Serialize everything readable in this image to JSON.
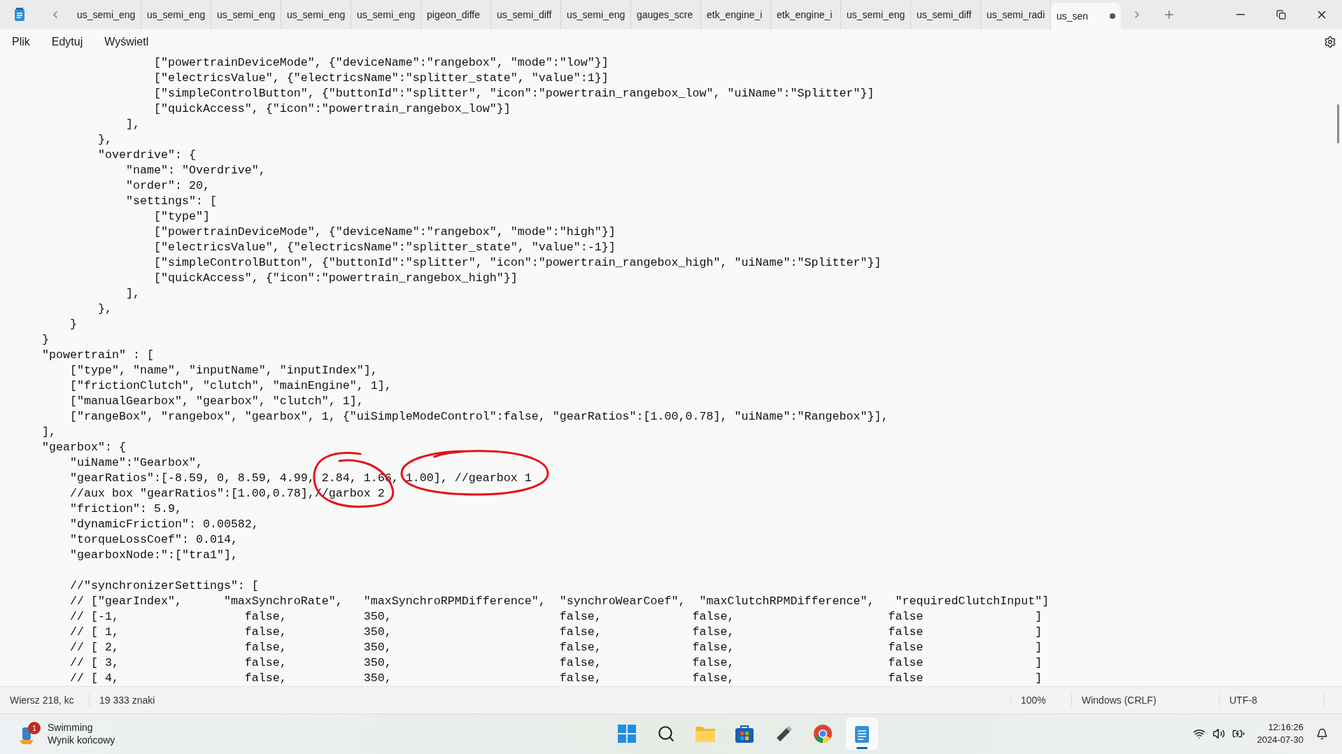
{
  "tabs": [
    {
      "label": "us_semi_eng",
      "selected": false,
      "unsaved": false
    },
    {
      "label": "us_semi_eng",
      "selected": false,
      "unsaved": false
    },
    {
      "label": "us_semi_eng",
      "selected": false,
      "unsaved": false
    },
    {
      "label": "us_semi_eng",
      "selected": false,
      "unsaved": false
    },
    {
      "label": "us_semi_eng",
      "selected": false,
      "unsaved": false
    },
    {
      "label": "pigeon_diffe",
      "selected": false,
      "unsaved": false
    },
    {
      "label": "us_semi_diff",
      "selected": false,
      "unsaved": false
    },
    {
      "label": "us_semi_eng",
      "selected": false,
      "unsaved": false
    },
    {
      "label": "gauges_scre",
      "selected": false,
      "unsaved": false
    },
    {
      "label": "etk_engine_i",
      "selected": false,
      "unsaved": false
    },
    {
      "label": "etk_engine_i",
      "selected": false,
      "unsaved": false
    },
    {
      "label": "us_semi_eng",
      "selected": false,
      "unsaved": false
    },
    {
      "label": "us_semi_diff",
      "selected": false,
      "unsaved": false
    },
    {
      "label": "us_semi_radi",
      "selected": false,
      "unsaved": false
    },
    {
      "label": "us_sen",
      "selected": true,
      "unsaved": true
    }
  ],
  "menu": [
    "Plik",
    "Edytuj",
    "Wyświetl"
  ],
  "editor": {
    "blocks": [
      [
        "                [\"powertrainDeviceMode\", {\"deviceName\":\"rangebox\", \"mode\":\"low\"}]",
        "                [\"electricsValue\", {\"electricsName\":\"splitter_state\", \"value\":1}]",
        "                [\"simpleControlButton\", {\"buttonId\":\"splitter\", \"icon\":\"powertrain_rangebox_low\", \"uiName\":\"Splitter\"}]",
        "                [\"quickAccess\", {\"icon\":\"powertrain_rangebox_low\"}]",
        "            ],",
        "        },",
        "        \"overdrive\": {",
        "            \"name\": \"Overdrive\",",
        "            \"order\": 20,",
        "            \"settings\": [",
        "                [\"type\"]",
        "                [\"powertrainDeviceMode\", {\"deviceName\":\"rangebox\", \"mode\":\"high\"}]",
        "                [\"electricsValue\", {\"electricsName\":\"splitter_state\", \"value\":-1}]",
        "                [\"simpleControlButton\", {\"buttonId\":\"splitter\", \"icon\":\"powertrain_rangebox_high\", \"uiName\":\"Splitter\"}]",
        "                [\"quickAccess\", {\"icon\":\"powertrain_rangebox_high\"}]",
        "            ],",
        "        },",
        "    }",
        "}",
        "\"powertrain\" : [",
        "    [\"type\", \"name\", \"inputName\", \"inputIndex\"],",
        "    [\"frictionClutch\", \"clutch\", \"mainEngine\", 1],",
        "    [\"manualGearbox\", \"gearbox\", \"clutch\", 1],",
        "    [\"rangeBox\", \"rangebox\", \"gearbox\", 1, {\"uiSimpleModeControl\":false, \"gearRatios\":[1.00,0.78], \"uiName\":\"Rangebox\"}],",
        "],",
        "\"gearbox\": {",
        "    \"uiName\":\"Gearbox\",",
        "    \"gearRatios\":[-8.59, 0, 8.59, 4.99, 2.84, 1.66, 1.00], //gearbox 1",
        "    //aux box \"gearRatios\":[1.00,0.78],//garbox 2",
        "    \"friction\": 5.9,",
        "    \"dynamicFriction\": 0.00582,",
        "    \"torqueLossCoef\": 0.014,",
        "    \"gearboxNode:\":[\"tra1\"],"
      ],
      [
        "    //\"synchronizerSettings\": [",
        "    // [\"gearIndex\",      \"maxSynchroRate\",   \"maxSynchroRPMDifference\",  \"synchroWearCoef\",  \"maxClutchRPMDifference\",   \"requiredClutchInput\"]",
        "    // [-1,                  false,           350,                        false,             false,                      false                ]",
        "    // [ 1,                  false,           350,                        false,             false,                      false                ]",
        "    // [ 2,                  false,           350,                        false,             false,                      false                ]",
        "    // [ 3,                  false,           350,                        false,             false,                      false                ]",
        "    // [ 4,                  false,           350,                        false,             false,                      false                ]"
      ]
    ]
  },
  "status_bar": {
    "position": "Wiersz 218, kc",
    "characters": "19 333 znaki",
    "zoom": "100%",
    "line_ending": "Windows (CRLF)",
    "encoding": "UTF-8"
  },
  "taskbar": {
    "widget": {
      "badge": "1",
      "title": "Swimming",
      "subtitle": "Wynik końcowy"
    },
    "time": "12:16:26",
    "date": "2024-07-30"
  }
}
